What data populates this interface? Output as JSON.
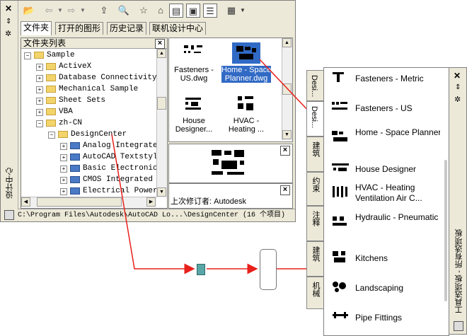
{
  "design_center": {
    "rail_title": "设计中心",
    "tabs": [
      "文件夹",
      "打开的图形",
      "历史记录",
      "联机设计中心"
    ],
    "tree_title": "文件夹列表",
    "tree": [
      {
        "label": "Sample",
        "indent": 0,
        "expander": "−",
        "icon": "folder"
      },
      {
        "label": "ActiveX",
        "indent": 1,
        "expander": "+",
        "icon": "folder"
      },
      {
        "label": "Database Connectivity",
        "indent": 1,
        "expander": "+",
        "icon": "folder"
      },
      {
        "label": "Mechanical Sample",
        "indent": 1,
        "expander": "+",
        "icon": "folder"
      },
      {
        "label": "Sheet Sets",
        "indent": 1,
        "expander": "+",
        "icon": "folder"
      },
      {
        "label": "VBA",
        "indent": 1,
        "expander": "+",
        "icon": "folder"
      },
      {
        "label": "zh-CN",
        "indent": 1,
        "expander": "−",
        "icon": "folder"
      },
      {
        "label": "DesignCenter",
        "indent": 2,
        "expander": "−",
        "icon": "folder"
      },
      {
        "label": "Analog Integrate",
        "indent": 3,
        "expander": "+",
        "icon": "doc"
      },
      {
        "label": "AutoCAD Textstyl",
        "indent": 3,
        "expander": "+",
        "icon": "doc"
      },
      {
        "label": "Basic Electronic",
        "indent": 3,
        "expander": "+",
        "icon": "doc"
      },
      {
        "label": "CMOS Integrated",
        "indent": 3,
        "expander": "+",
        "icon": "doc"
      },
      {
        "label": "Electrical Power",
        "indent": 3,
        "expander": "+",
        "icon": "doc"
      }
    ],
    "content_items": [
      {
        "label": "Fasteners -\nUS.dwg",
        "selected": false
      },
      {
        "label": "Home - Space\nPlanner.dwg",
        "selected": true
      },
      {
        "label": "House\nDesigner...",
        "selected": false
      },
      {
        "label": "HVAC -\nHeating ...",
        "selected": false
      }
    ],
    "description": "上次修订者: Autodesk",
    "status_path": "C:\\Program Files\\Autodesk\\AutoCAD Lo...\\DesignCenter (16 个项目)",
    "close_glyph": "×"
  },
  "tool_palette": {
    "rail_title": "工具选项板 - 所有选项板",
    "tabs": [
      "Desi...",
      "Desi...",
      "建筑",
      "约束",
      "注释",
      "建筑",
      "机械"
    ],
    "items": [
      {
        "label": "Fasteners - Metric"
      },
      {
        "label": "Fasteners - US"
      },
      {
        "label": "Home - Space Planner"
      },
      {
        "label": "House Designer"
      },
      {
        "label": "HVAC - Heating Ventilation Air C..."
      },
      {
        "label": "Hydraulic - Pneumatic"
      },
      {
        "label": "Kitchens"
      },
      {
        "label": "Landscaping"
      },
      {
        "label": "Pipe Fittings"
      }
    ]
  },
  "colors": {
    "arrow": "#e8201c",
    "selection": "#316ac5"
  }
}
